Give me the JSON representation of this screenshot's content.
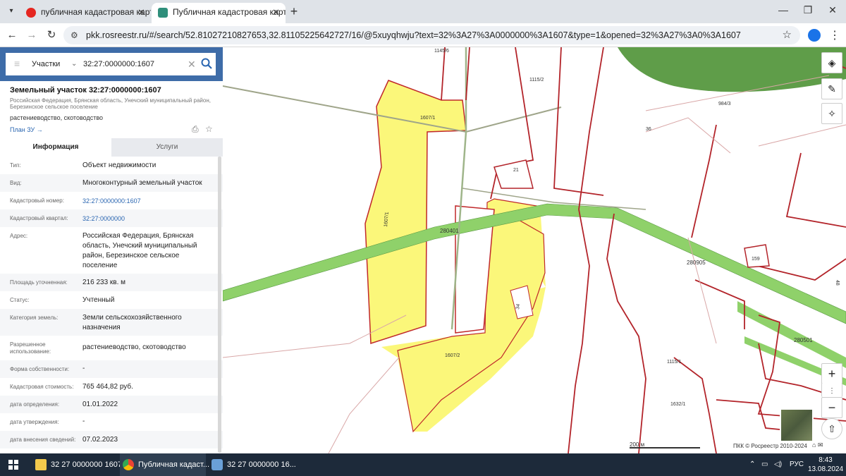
{
  "browser": {
    "tabs": [
      {
        "title": "публичная кадастровая карта",
        "active": false
      },
      {
        "title": "Публичная кадастровая карта",
        "active": true
      }
    ],
    "url": "pkk.rosreestr.ru/#/search/52.81027210827653,32.81105225642727/16/@5xuyqhwju?text=32%3A27%3A0000000%3A1607&type=1&opened=32%3A27%3A0%3A1607"
  },
  "search": {
    "type": "Участки",
    "query": "32:27:0000000:1607"
  },
  "card": {
    "title": "Земельный участок 32:27:0000000:1607",
    "address_line": "Российская Федерация, Брянская область, Унечский муниципальный район, Березинское сельское поселение",
    "use_line": "растениеводство, скотоводство",
    "plan_link": "План ЗУ →",
    "tabs": [
      "Информация",
      "Услуги"
    ],
    "rows": [
      {
        "key": "Тип:",
        "value": "Объект недвижимости"
      },
      {
        "key": "Вид:",
        "value": "Многоконтурный земельный участок"
      },
      {
        "key": "Кадастровый номер:",
        "value": "32:27:0000000:1607"
      },
      {
        "key": "Кадастровый квартал:",
        "value": "32:27:0000000"
      },
      {
        "key": "Адрес:",
        "value": "Российская Федерация, Брянская область, Унечский муниципальный район, Березинское сельское поселение"
      },
      {
        "key": "Площадь уточненная:",
        "value": "216 233 кв. м"
      },
      {
        "key": "Статус:",
        "value": "Учтенный"
      },
      {
        "key": "Категория земель:",
        "value": "Земли сельскохозяйственного назначения"
      },
      {
        "key": "Разрешенное использование:",
        "value": "растениеводство, скотоводство"
      },
      {
        "key": "Форма собственности:",
        "value": "-"
      },
      {
        "key": "Кадастровая стоимость:",
        "value": "765 464,82 руб."
      },
      {
        "key": "дата определения:",
        "value": "01.01.2022"
      },
      {
        "key": "дата утверждения:",
        "value": "-"
      },
      {
        "key": "дата внесения сведений:",
        "value": "07.02.2023"
      }
    ]
  },
  "map": {
    "labels": {
      "l1145_6": "1145/6",
      "l1115_2": "1115/2",
      "l984_3": "984/3",
      "l36": "36",
      "l1607_1a": "1607/1",
      "l1607_1b": "1607/1",
      "l21": "21",
      "l280401": "280401",
      "l280905": "280905",
      "l159": "159",
      "l34": "34",
      "l1607_2": "1607/2",
      "l1115_1": "1115/1",
      "l1632_1": "1632/1",
      "l280501": "280501",
      "l48": "48"
    },
    "scale": "200 м",
    "copyright": "ПКК © Росреестр 2010-2024"
  },
  "taskbar": {
    "items": [
      "32 27 0000000 1607",
      "Публичная кадаст...",
      "32 27 0000000 16..."
    ],
    "lang": "РУС",
    "time": "8:43",
    "date": "13.08.2024"
  },
  "colors": {
    "parcel_fill": "#fbf77a",
    "parcel_border": "#c0282a",
    "road_green": "#8fd16a",
    "forest": "#5f9d49",
    "panel_header": "#3e6ca8"
  }
}
